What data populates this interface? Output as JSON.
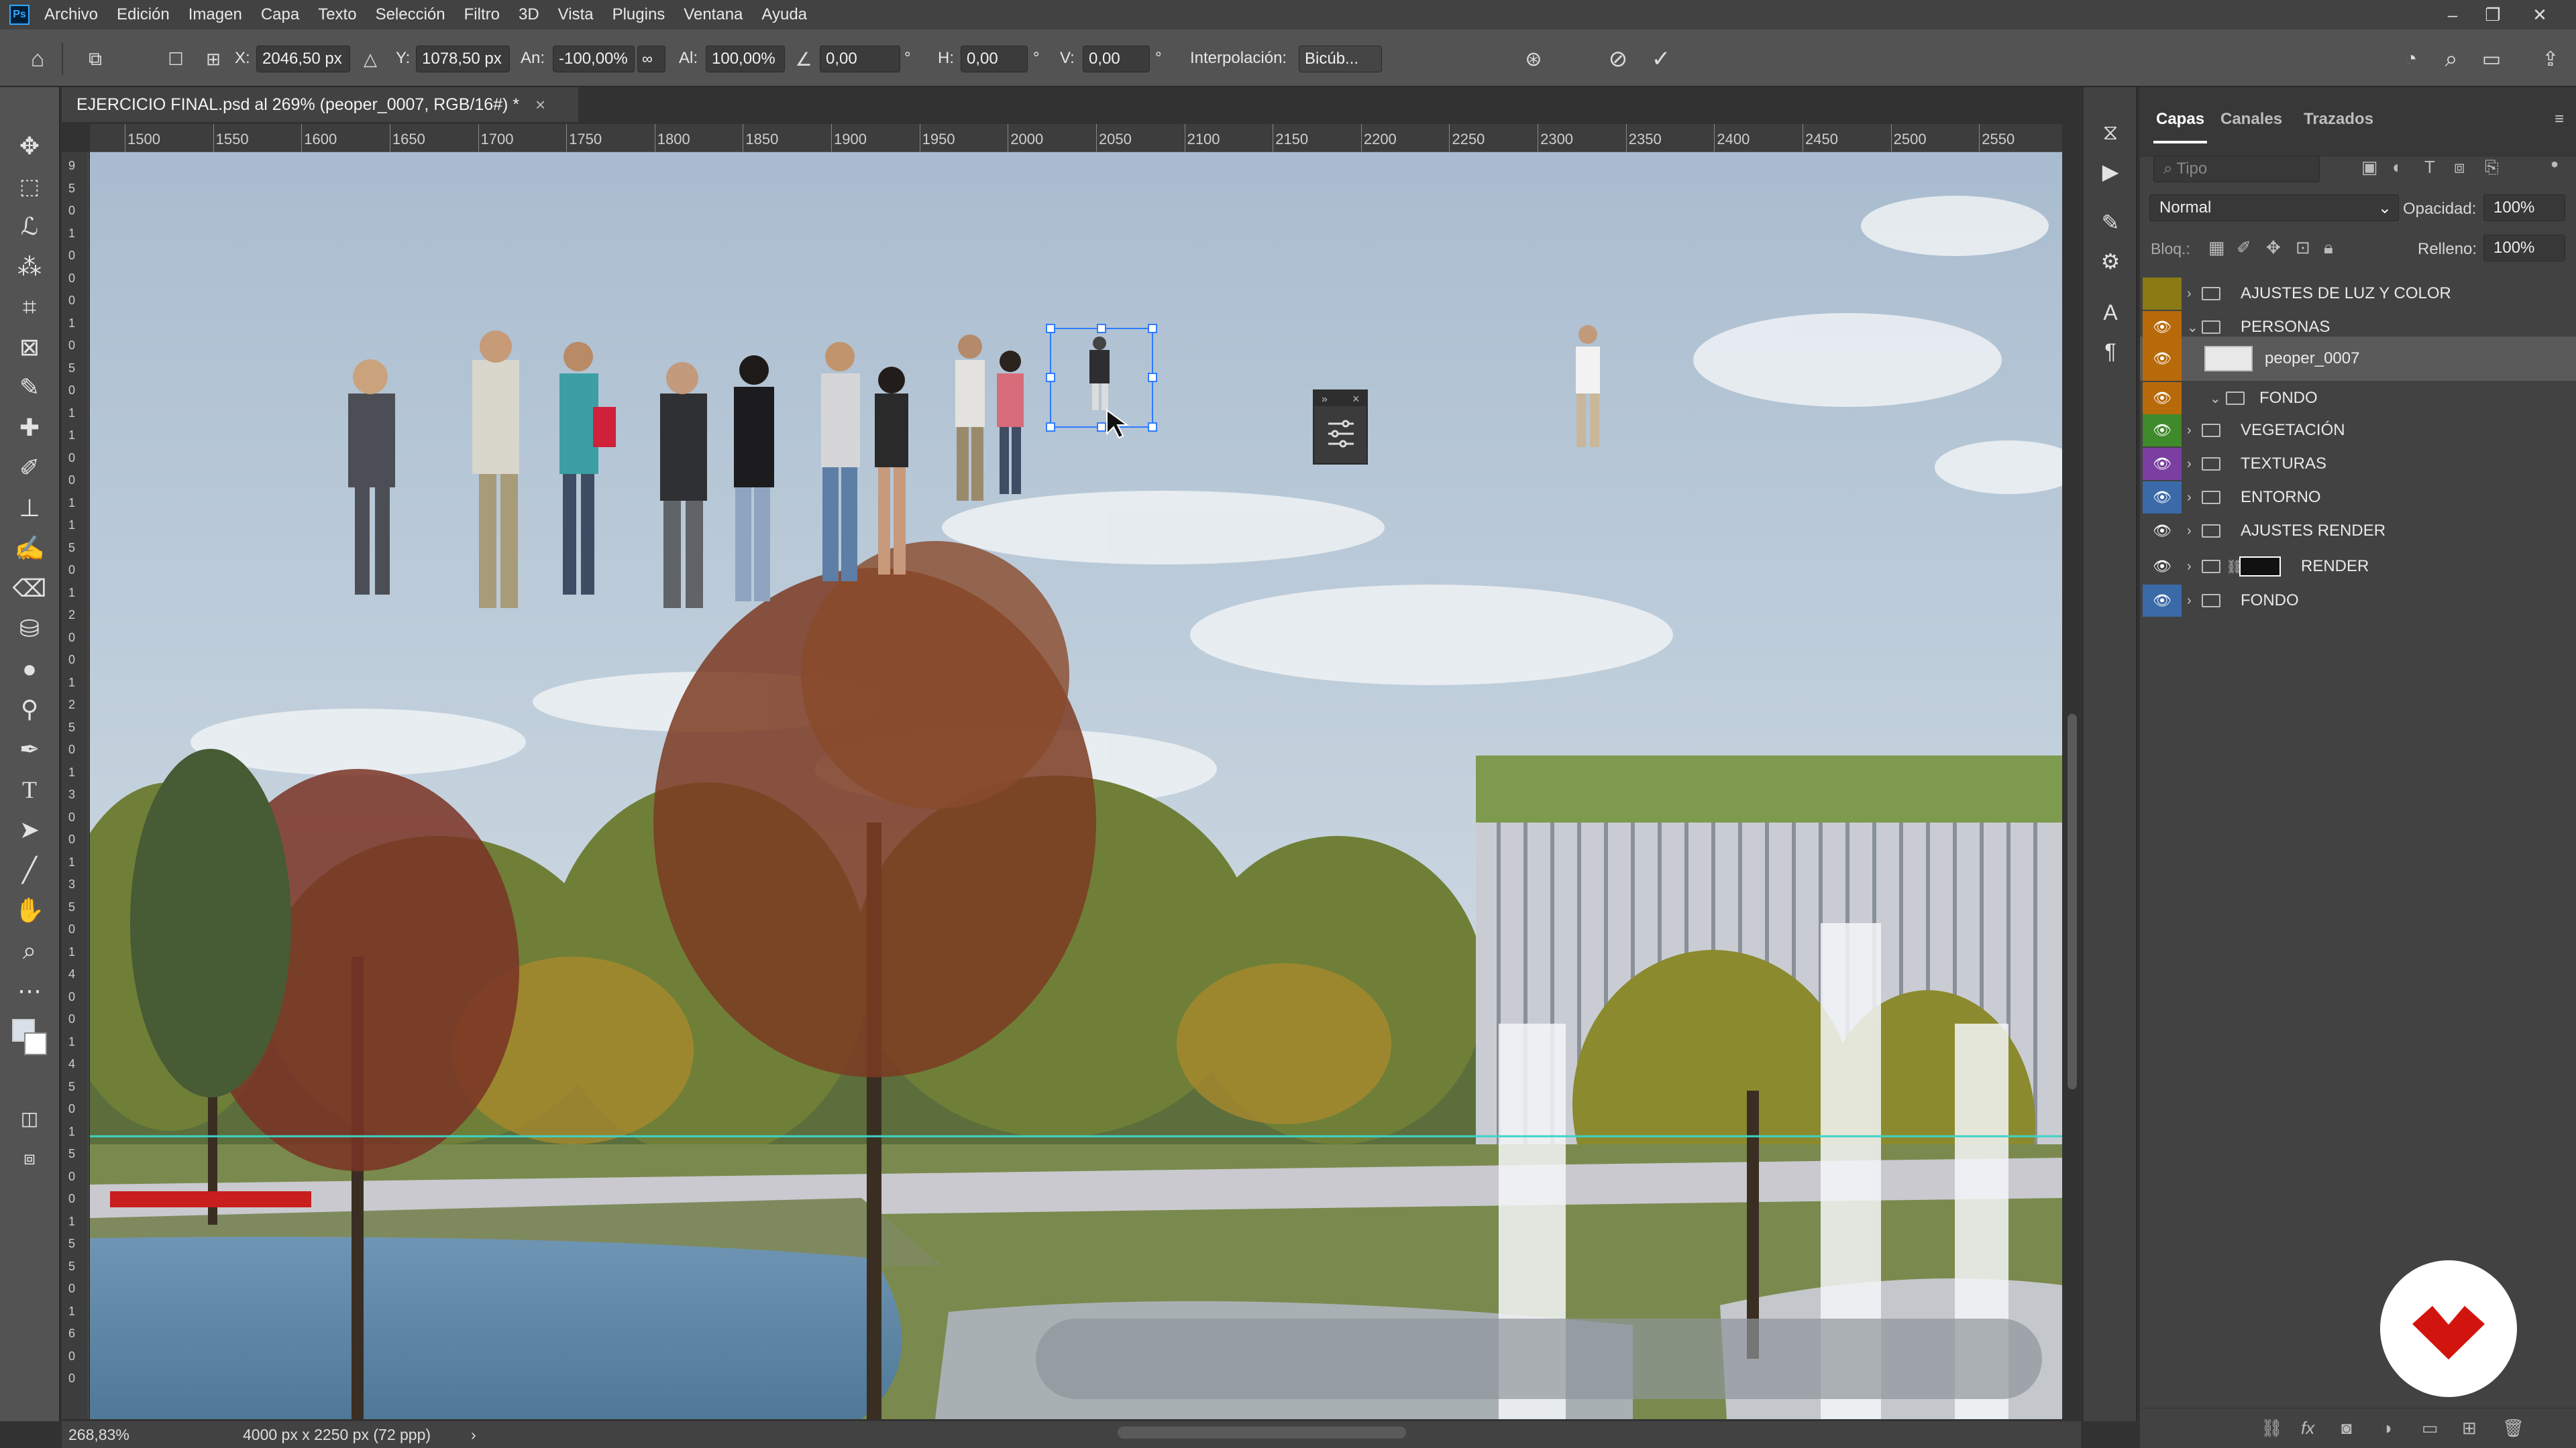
{
  "menubar": {
    "app_icon": "Ps",
    "items": [
      "Archivo",
      "Edición",
      "Imagen",
      "Capa",
      "Texto",
      "Selección",
      "Filtro",
      "3D",
      "Vista",
      "Plugins",
      "Ventana",
      "Ayuda"
    ]
  },
  "options": {
    "x_label": "X:",
    "x_value": "2046,50 px",
    "y_label": "Y:",
    "y_value": "1078,50 px",
    "an_label": "An:",
    "an_value": "-100,00%",
    "al_label": "Al:",
    "al_value": "100,00%",
    "angle_value": "0,00",
    "angle_unit": "°",
    "h_label": "H:",
    "h_value": "0,00",
    "h_unit": "°",
    "v_label": "V:",
    "v_value": "0,00",
    "v_unit": "°",
    "interp_label": "Interpolación:",
    "interp_value": "Bicúb..."
  },
  "document": {
    "tab_title": "EJERCICIO FINAL.psd al 269% (peoper_0007, RGB/16#) *",
    "close": "×"
  },
  "ruler": {
    "h_ticks": [
      "1500",
      "1550",
      "1600",
      "1650",
      "1700",
      "1750",
      "1800",
      "1850",
      "1900",
      "1950",
      "2000",
      "2050",
      "2100",
      "2150",
      "2200",
      "2250",
      "2300",
      "2350",
      "2400",
      "2450",
      "2500",
      "2550"
    ],
    "v_ticks": [
      "9",
      "5",
      "0",
      "1",
      "0",
      "0",
      "0",
      "1",
      "0",
      "5",
      "0",
      "1",
      "1",
      "0",
      "0",
      "1",
      "1",
      "5",
      "0",
      "1",
      "2",
      "0",
      "0",
      "1",
      "2",
      "5",
      "0",
      "1",
      "3",
      "0",
      "0",
      "1",
      "3",
      "5",
      "0",
      "1",
      "4",
      "0",
      "0",
      "1",
      "4",
      "5",
      "0",
      "1",
      "5",
      "0",
      "0",
      "1",
      "5",
      "5",
      "0",
      "1",
      "6",
      "0",
      "0"
    ]
  },
  "status": {
    "zoom": "268,83%",
    "doc_size": "4000 px x 2250 px (72 ppp)",
    "arrow": "›"
  },
  "layers_panel": {
    "tabs": [
      "Capas",
      "Canales",
      "Trazados"
    ],
    "search_placeholder": "Tipo",
    "blend_mode": "Normal",
    "opacity_label": "Opacidad:",
    "opacity_value": "100%",
    "lock_label": "Bloq.:",
    "fill_label": "Relleno:",
    "fill_value": "100%",
    "layers": [
      {
        "name": "AJUSTES DE LUZ Y COLOR",
        "color": "#8a7a14",
        "visible": false,
        "expanded": false
      },
      {
        "name": "PERSONAS",
        "color": "#b86a0a",
        "visible": true,
        "expanded": true
      },
      {
        "name": "peoper_0007",
        "color": "#b86a0a",
        "visible": true,
        "selected": true
      },
      {
        "name": "FONDO",
        "color": "#b86a0a",
        "visible": true,
        "expanded": true
      },
      {
        "name": "VEGETACIÓN",
        "color": "#3f8a2a",
        "visible": true,
        "expanded": false
      },
      {
        "name": "TEXTURAS",
        "color": "#7a3fa0",
        "visible": true,
        "expanded": false
      },
      {
        "name": "ENTORNO",
        "color": "#3a6aa8",
        "visible": true,
        "expanded": false
      },
      {
        "name": "AJUSTES RENDER",
        "color": "#424242",
        "visible": true,
        "expanded": false
      },
      {
        "name": "RENDER",
        "color": "#424242",
        "visible": true,
        "expanded": false
      },
      {
        "name": "FONDO",
        "color": "#3a6aa8",
        "visible": true,
        "expanded": false
      }
    ]
  },
  "colors": {
    "guide": "#3fd3c8",
    "selection": "#2f7bff",
    "logo_red": "#d2140f"
  },
  "icons": {
    "home": "home-icon",
    "move": "move-tool-icon",
    "search": "search-icon",
    "cancel": "cancel-icon",
    "commit": "commit-icon"
  }
}
